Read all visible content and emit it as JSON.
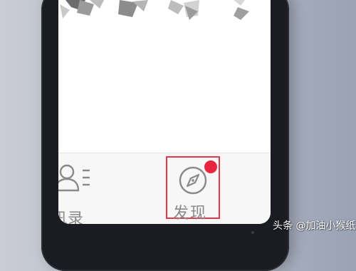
{
  "tabbar": {
    "contacts": {
      "label": "讯录",
      "icon": "contacts-icon"
    },
    "discover": {
      "label": "发现",
      "icon": "compass-icon",
      "badge_color": "#e8253f",
      "highlight_color": "#e23a4b"
    }
  },
  "watermark": {
    "text": "头条 @加油小猴纸"
  },
  "colors": {
    "screen_bg": "#ffffff",
    "tabbar_bg": "#f7f7f7",
    "icon_gray": "#8a8a8a",
    "phone_frame": "#1b1c21"
  }
}
